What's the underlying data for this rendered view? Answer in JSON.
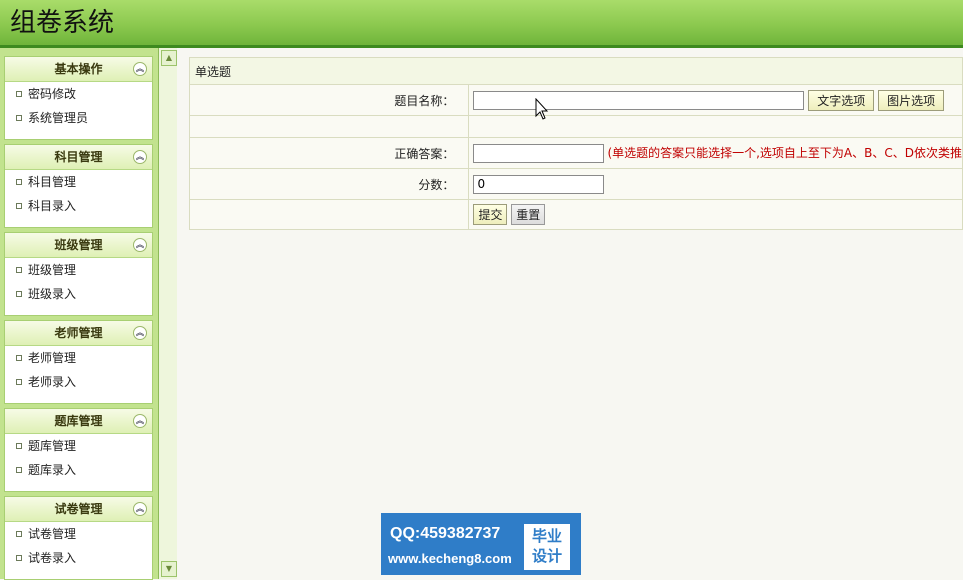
{
  "app": {
    "title": "组卷系统"
  },
  "sidebar": {
    "panels": [
      {
        "title": "基本操作",
        "items": [
          "密码修改",
          "系统管理员"
        ]
      },
      {
        "title": "科目管理",
        "items": [
          "科目管理",
          "科目录入"
        ]
      },
      {
        "title": "班级管理",
        "items": [
          "班级管理",
          "班级录入"
        ]
      },
      {
        "title": "老师管理",
        "items": [
          "老师管理",
          "老师录入"
        ]
      },
      {
        "title": "题库管理",
        "items": [
          "题库管理",
          "题库录入"
        ]
      },
      {
        "title": "试卷管理",
        "items": [
          "试卷管理",
          "试卷录入"
        ]
      }
    ]
  },
  "form": {
    "caption": "单选题",
    "question_label": "题目名称：",
    "question_value": "",
    "text_option_button": "文字选项",
    "image_option_button": "图片选项",
    "answer_label": "正确答案：",
    "answer_value": "",
    "answer_hint": "(单选题的答案只能选择一个,选项自上至下为A、B、C、D依次类推",
    "score_label": "分数：",
    "score_value": "0",
    "submit_button": "提交",
    "reset_button": "重置"
  },
  "watermark": {
    "qq": "QQ:459382737",
    "url": "www.kecheng8.com",
    "badge_line1": "毕业",
    "badge_line2": "设计"
  },
  "colors": {
    "header_green": "#8cc94f",
    "sidebar_green": "#c2e38e",
    "hint_red": "#c00000",
    "watermark_blue": "#2f7dc8"
  }
}
